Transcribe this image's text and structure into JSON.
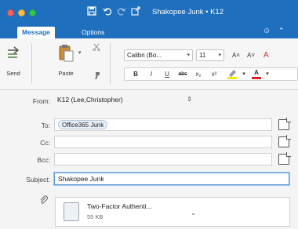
{
  "window": {
    "title": "Shakopee Junk • K12",
    "toolbar_icons": [
      "save-icon",
      "undo-icon",
      "redo-icon",
      "customize-icon"
    ]
  },
  "tabs": [
    {
      "label": "Message",
      "active": true
    },
    {
      "label": "Options",
      "active": false
    }
  ],
  "ribbon": {
    "send_label": "Send",
    "paste_label": "Paste",
    "font_name": "Calibri (Bo...",
    "font_size": "11",
    "grow_font": "A˄",
    "shrink_font": "A˅",
    "bold": "B",
    "italic": "I",
    "underline": "U",
    "strike": "abc",
    "subscript": "x₂",
    "superscript": "x²",
    "highlight_color": "#f7e600",
    "font_color": "#e02020",
    "font_color_glyph": "A"
  },
  "header": {
    "from_label": "From:",
    "from_value": "K12 (Lee,Christopher)",
    "to_label": "To:",
    "to_recipient": "Office365 Junk",
    "cc_label": "Cc:",
    "bcc_label": "Bcc:",
    "subject_label": "Subject:",
    "subject_value": "Shakopee Junk"
  },
  "attachment": {
    "name": "Two-Factor Authenti...",
    "size": "55 KB"
  },
  "colors": {
    "title_bar": "#1f6fbf",
    "accent": "#1f6fbf"
  }
}
